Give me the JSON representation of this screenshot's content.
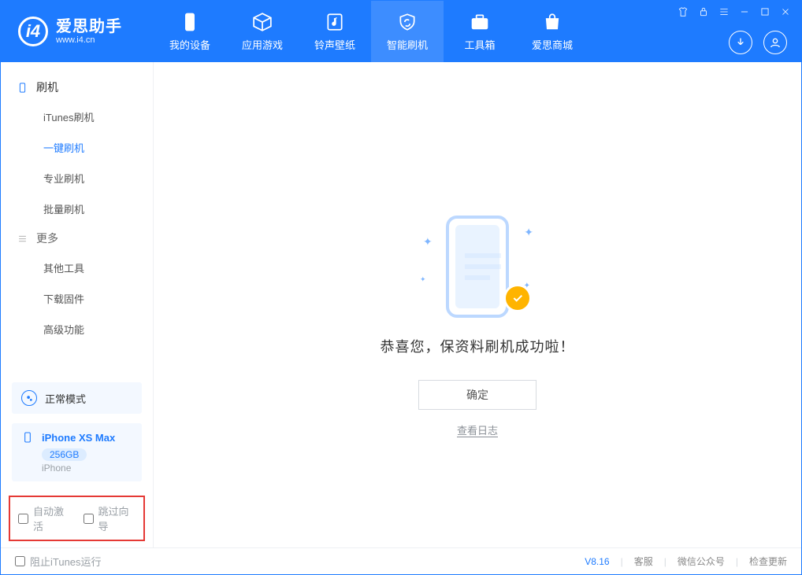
{
  "app": {
    "name": "爱思助手",
    "url": "www.i4.cn"
  },
  "tabs": [
    {
      "label": "我的设备"
    },
    {
      "label": "应用游戏"
    },
    {
      "label": "铃声壁纸"
    },
    {
      "label": "智能刷机"
    },
    {
      "label": "工具箱"
    },
    {
      "label": "爱思商城"
    }
  ],
  "sidebar": {
    "section_flash": "刷机",
    "flash_items": [
      "iTunes刷机",
      "一键刷机",
      "专业刷机",
      "批量刷机"
    ],
    "section_more": "更多",
    "more_items": [
      "其他工具",
      "下载固件",
      "高级功能"
    ]
  },
  "mode": {
    "label": "正常模式"
  },
  "device": {
    "name": "iPhone XS Max",
    "storage": "256GB",
    "type": "iPhone"
  },
  "redbox": {
    "auto_activate": "自动激活",
    "skip_setup": "跳过向导"
  },
  "main": {
    "message": "恭喜您，保资料刷机成功啦！",
    "confirm": "确定",
    "view_log": "查看日志"
  },
  "footer": {
    "block_itunes": "阻止iTunes运行",
    "version": "V8.16",
    "service": "客服",
    "wechat": "微信公众号",
    "update": "检查更新"
  }
}
